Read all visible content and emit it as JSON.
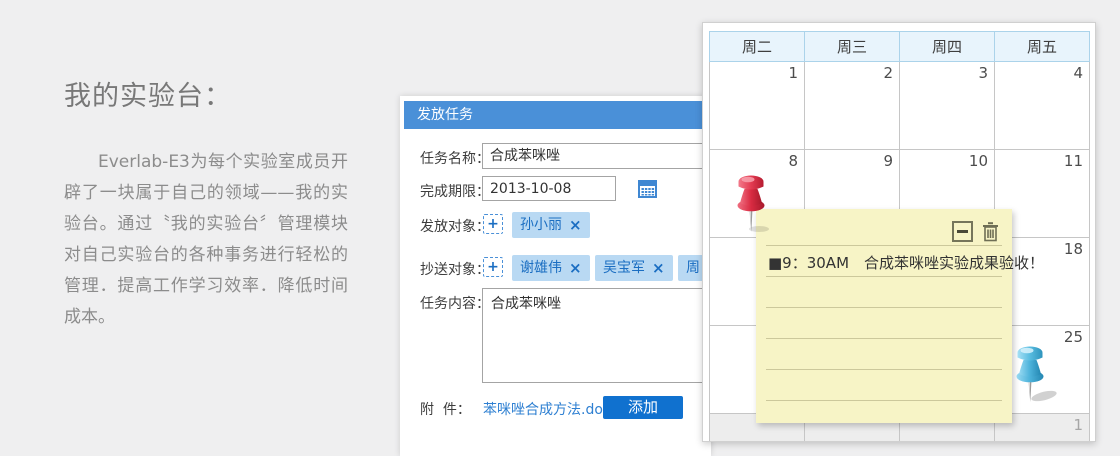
{
  "colors": {
    "page_background": "#efeff0",
    "dialog_header": "#4a90d8",
    "chip_background": "#b9d9f3",
    "chip_text": "#1b6ec2",
    "primary_button": "#1071cf",
    "link": "#2f80d2",
    "calendar_header_bg": "#e8f4fc",
    "calendar_header_border": "#abd3ea",
    "note_background": "#f7f4c6",
    "pin_red": "#d9384d",
    "pin_blue": "#55b9dd"
  },
  "icons": {
    "date_picker": "calendar-grid-icon",
    "add_person": "+",
    "chip_remove": "×",
    "note_collapse": "minus-box",
    "note_delete": "trash",
    "pins": [
      "red-pushpin",
      "blue-pushpin"
    ]
  },
  "intro": {
    "title": "我的实验台：",
    "paragraph": "Everlab-E3为每个实验室成员开辟了一块属于自己的领域——我的实验台。通过〝我的实验台〞管理模块对自己实验台的各种事务进行轻松的管理．提高工作学习效率．降低时间成本。"
  },
  "dialog": {
    "title": "发放任务",
    "task_name": {
      "label": "任务名称：",
      "value": "合成苯咪唑"
    },
    "deadline": {
      "label": "完成期限：",
      "value": "2013-10-08"
    },
    "assign": {
      "label": "发放对象：",
      "add_glyph": "+",
      "chips": [
        {
          "name": "孙小丽"
        }
      ]
    },
    "cc": {
      "label": "抄送对象：",
      "add_glyph": "+",
      "chips": [
        {
          "name": "谢雄伟"
        },
        {
          "name": "吴宝军"
        },
        {
          "name": "周日"
        }
      ]
    },
    "remove_glyph": "×",
    "content": {
      "label": "任务内容：",
      "value": "合成苯咪唑"
    },
    "attachment": {
      "label": "附  件：",
      "file_name": "苯咪唑合成方法.docx",
      "add_button": "添加"
    }
  },
  "calendar": {
    "weekdays": [
      "周二",
      "周三",
      "周四",
      "周五"
    ],
    "rows": [
      [
        "1",
        "2",
        "3",
        "4"
      ],
      [
        "8",
        "9",
        "10",
        "11"
      ],
      [
        "",
        "",
        "",
        "18"
      ],
      [
        "",
        "",
        "",
        "25"
      ],
      [
        "",
        "",
        "",
        "1"
      ]
    ]
  },
  "sticky_note": {
    "text": "■9：30AM　合成苯咪唑实验成果验收！"
  }
}
